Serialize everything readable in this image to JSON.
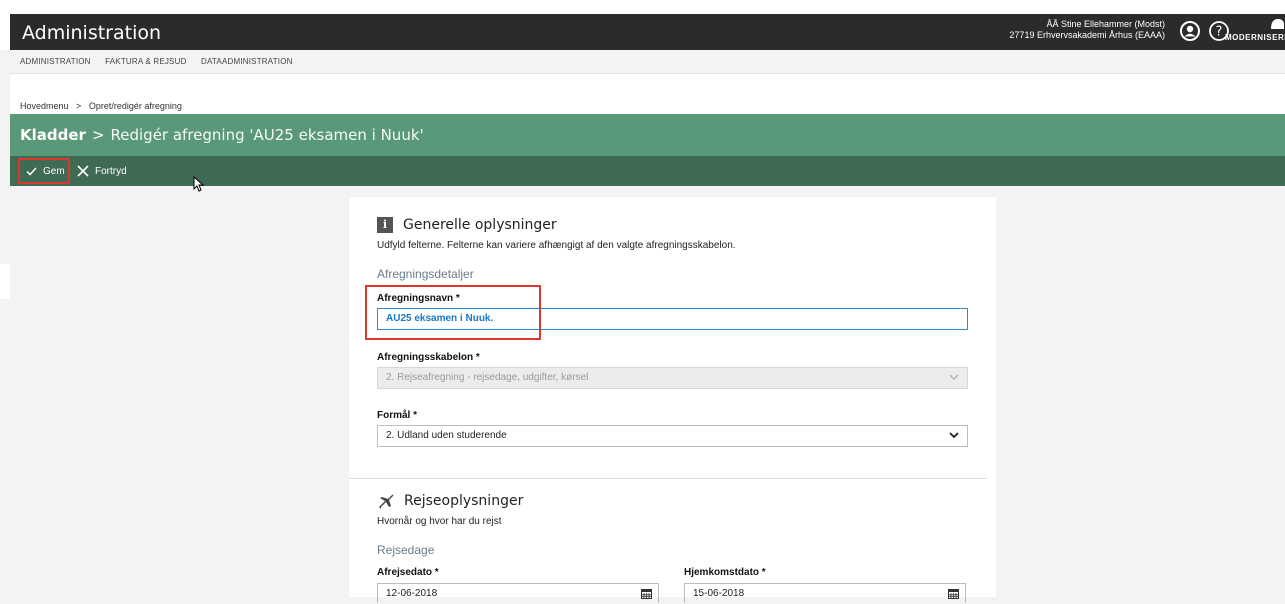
{
  "header": {
    "app_title": "Administration",
    "user_line1": "ÅÅ Stine Ellehammer (Modst)",
    "user_line2": "27719 Erhvervsakademi Århus (EAAA)",
    "brand_text": "MODERNISERIN"
  },
  "menu": {
    "items": [
      "ADMINISTRATION",
      "FAKTURA & REJSUD",
      "DATAADMINISTRATION"
    ]
  },
  "breadcrumb": {
    "home": "Hovedmenu",
    "sep": ">",
    "current": "Opret/redigér afregning"
  },
  "page_header": {
    "section": "Kladder",
    "sep": ">",
    "title": "Redigér afregning 'AU25 eksamen i Nuuk'"
  },
  "toolbar": {
    "save_label": "Gem",
    "cancel_label": "Fortryd"
  },
  "general": {
    "heading": "Generelle oplysninger",
    "subtitle": "Udfyld felterne. Felterne kan variere afhængigt af den valgte afregningsskabelon.",
    "group": "Afregningsdetaljer",
    "name_label": "Afregningsnavn *",
    "name_value": "AU25 eksamen i Nuuk.",
    "template_label": "Afregningsskabelon *",
    "template_value": "2. Rejseafregning - rejsedage, udgifter, kørsel",
    "purpose_label": "Formål *",
    "purpose_value": "2. Udland uden studerende"
  },
  "travel": {
    "heading": "Rejseoplysninger",
    "subtitle": "Hvornår og hvor har du rejst",
    "group": "Rejsedage",
    "depart_label": "Afrejsedato *",
    "depart_value": "12-06-2018",
    "return_label": "Hjemkomstdato *",
    "return_value": "15-06-2018"
  },
  "colors": {
    "green_header": "#5a987a",
    "toolbar": "#3f6b55",
    "highlight": "#d9392c",
    "focus": "#2a8bd6"
  }
}
